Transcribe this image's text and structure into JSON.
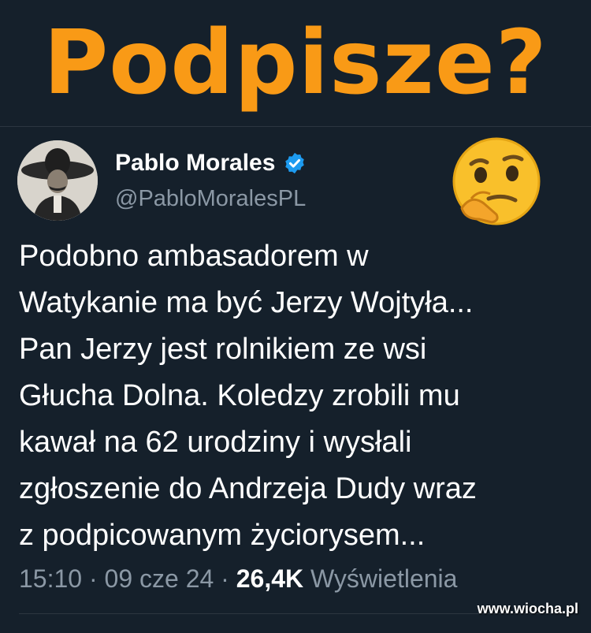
{
  "headline": "Podpisze?",
  "author": {
    "name": "Pablo Morales",
    "handle": "@PabloMoralesPL"
  },
  "tweet": {
    "text": "Podobno ambasadorem w\nWatykanie ma być Jerzy Wojtyła...\nPan Jerzy jest rolnikiem ze wsi\nGłucha Dolna. Koledzy zrobili mu\nkawał na 62 urodziny i wysłali\nzgłoszenie do Andrzeja Dudy wraz\nz podpicowanym życiorysem...",
    "time": "15:10",
    "date": "09 cze 24",
    "views_count": "26,4K",
    "views_label": "Wyświetlenia"
  },
  "watermark": "www.wiocha.pl",
  "colors": {
    "headline": "#f99a16",
    "background": "#15202b",
    "verified": "#1d9bf0",
    "muted": "#8b98a5"
  },
  "icons": {
    "verified": "verified-badge-icon",
    "emoji": "thinking-face-icon"
  }
}
